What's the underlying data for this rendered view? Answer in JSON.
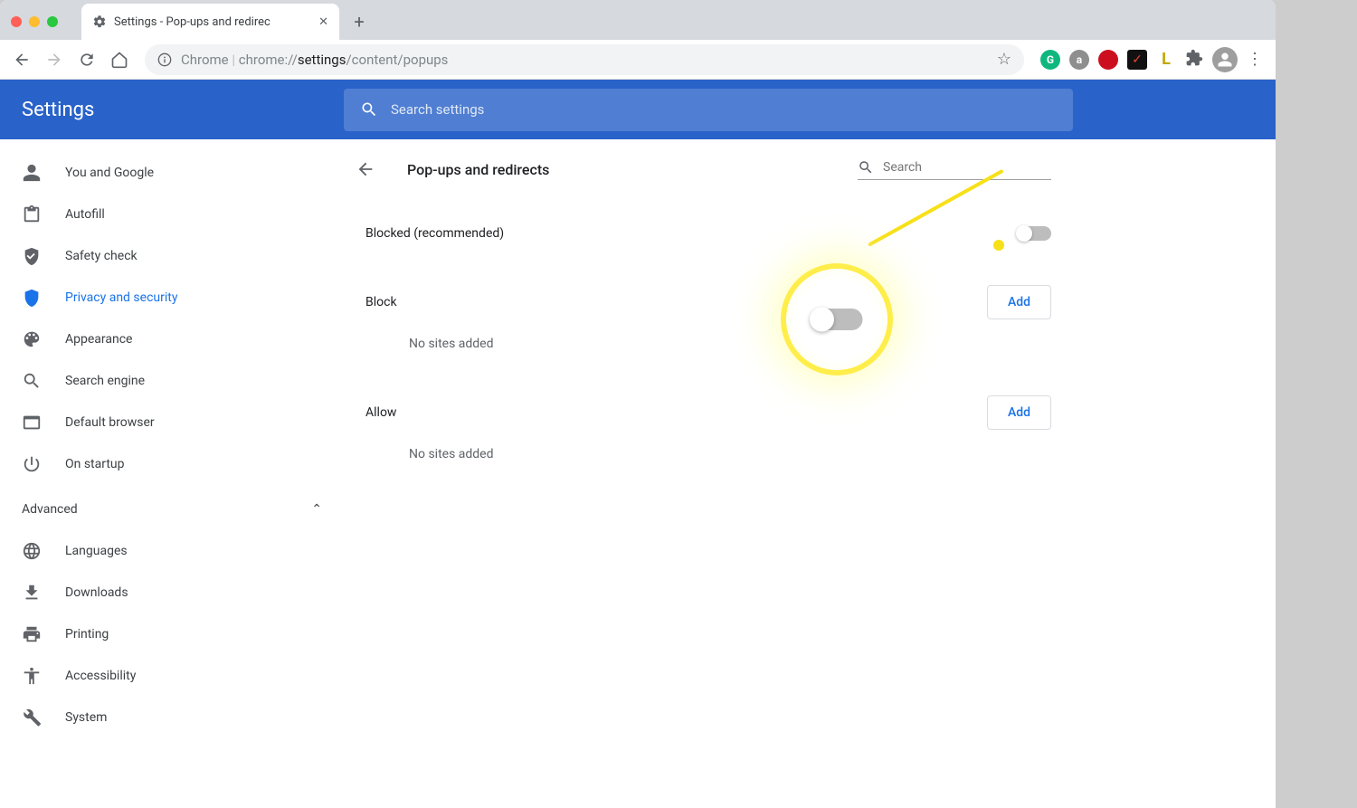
{
  "tab": {
    "title": "Settings - Pop-ups and redirec"
  },
  "omnibox": {
    "scheme": "Chrome",
    "prefix": "chrome://",
    "bold": "settings",
    "rest": "/content/popups"
  },
  "settings_title": "Settings",
  "search_settings_placeholder": "Search settings",
  "sidebar": {
    "items": [
      {
        "label": "You and Google"
      },
      {
        "label": "Autofill"
      },
      {
        "label": "Safety check"
      },
      {
        "label": "Privacy and security"
      },
      {
        "label": "Appearance"
      },
      {
        "label": "Search engine"
      },
      {
        "label": "Default browser"
      },
      {
        "label": "On startup"
      }
    ],
    "advanced_label": "Advanced",
    "adv_items": [
      {
        "label": "Languages"
      },
      {
        "label": "Downloads"
      },
      {
        "label": "Printing"
      },
      {
        "label": "Accessibility"
      },
      {
        "label": "System"
      }
    ]
  },
  "panel": {
    "title": "Pop-ups and redirects",
    "search_placeholder": "Search",
    "blocked_label": "Blocked (recommended)",
    "block_label": "Block",
    "allow_label": "Allow",
    "add_label": "Add",
    "empty_msg": "No sites added"
  }
}
